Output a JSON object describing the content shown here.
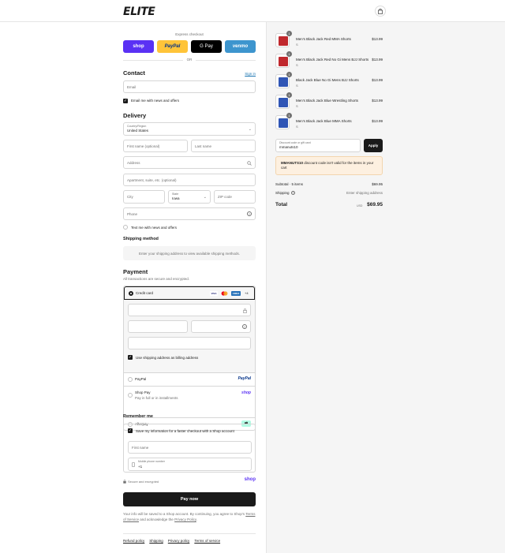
{
  "brand": {
    "logo_text": "ELITE"
  },
  "express": {
    "label": "Express checkout",
    "buttons": [
      {
        "label": "shop",
        "bg": "#5a31f4",
        "fg": "#ffffff"
      },
      {
        "label": "PayPal",
        "bg": "#ffc439",
        "fg": "#003087"
      },
      {
        "label": "G Pay",
        "bg": "#000000",
        "fg": "#ffffff"
      },
      {
        "label": "venmo",
        "bg": "#3d95ce",
        "fg": "#ffffff"
      }
    ],
    "or_label": "OR"
  },
  "contact": {
    "title": "Contact",
    "sign_in": "Sign in",
    "email_placeholder": "Email",
    "newsletter_label": "Email me with news and offers",
    "newsletter_checked": true
  },
  "delivery": {
    "title": "Delivery",
    "country_label": "Country/Region",
    "country_value": "United States",
    "first_name_placeholder": "First name (optional)",
    "last_name_placeholder": "Last name",
    "address_placeholder": "Address",
    "apartment_placeholder": "Apartment, suite, etc. (optional)",
    "city_placeholder": "City",
    "state_label": "State",
    "state_value": "Iowa",
    "zip_placeholder": "ZIP code",
    "phone_placeholder": "Phone",
    "text_offers_label": "Text me with news and offers"
  },
  "shipping_method": {
    "title": "Shipping method",
    "notice": "Enter your shipping address to view available shipping methods."
  },
  "payment": {
    "title": "Payment",
    "subtitle": "All transactions are secure and encrypted.",
    "credit_card_label": "Credit card",
    "card_badges": [
      "VISA",
      "MC",
      "AMEX"
    ],
    "more_cards": "+4",
    "billing_same_label": "Use shipping address as billing address",
    "options": [
      {
        "label": "PayPal",
        "sub": "",
        "logo": "PayPal"
      },
      {
        "label": "Shop Pay",
        "sub": "Pay in full or in installments",
        "logo": "shop"
      },
      {
        "label": "Afterpay",
        "sub": "",
        "logo": "afterpay-icon"
      }
    ]
  },
  "remember": {
    "title": "Remember me",
    "save_label": "Save my information for a faster checkout with a Shop account",
    "first_name_placeholder": "First name",
    "mobile_label": "Mobile phone number",
    "mobile_value": "+1",
    "secure_label": "Secure and encrypted",
    "shop_logo": "shop"
  },
  "pay_now": "Pay now",
  "legal": {
    "text_1": "Your info will be saved to a Shop account. By continuing, you agree to Shop's",
    "terms_link": "Terms of Service",
    "text_2": "and acknowledge the",
    "privacy_link": "Privacy Policy",
    "text_3": "."
  },
  "footer_links": [
    "Refund policy",
    "Shipping",
    "Privacy policy",
    "Terms of service"
  ],
  "cart": {
    "items": [
      {
        "name": "Men's Black Jack Red MMA Shorts",
        "variant": "S",
        "price": "$13.99",
        "qty": "1",
        "color": "#c0282d"
      },
      {
        "name": "Men's Black Jack Red No Gi Mens BJJ Shorts",
        "variant": "S",
        "price": "$13.99",
        "qty": "1",
        "color": "#c0282d"
      },
      {
        "name": "Black Jack Blue No Gi Mens BJJ Shorts",
        "variant": "S",
        "price": "$13.99",
        "qty": "1",
        "color": "#2f55b5"
      },
      {
        "name": "Men's Black Jack Blue Wrestling Shorts",
        "variant": "S",
        "price": "$13.99",
        "qty": "1",
        "color": "#2f55b5"
      },
      {
        "name": "Men's Black Jack Blue MMA Shorts",
        "variant": "S",
        "price": "$13.99",
        "qty": "1",
        "color": "#2f55b5"
      }
    ],
    "discount_label": "Discount code or gift card",
    "discount_value": "mmanuts10",
    "apply_label": "Apply",
    "error_code": "MMANUTS10",
    "error_text": "discount code isn't valid for the items in your cart",
    "subtotal_label": "Subtotal · 5 items",
    "subtotal_value": "$69.95",
    "shipping_label": "Shipping",
    "shipping_value": "Enter shipping address",
    "total_label": "Total",
    "currency": "USD",
    "total_value": "$69.95"
  }
}
